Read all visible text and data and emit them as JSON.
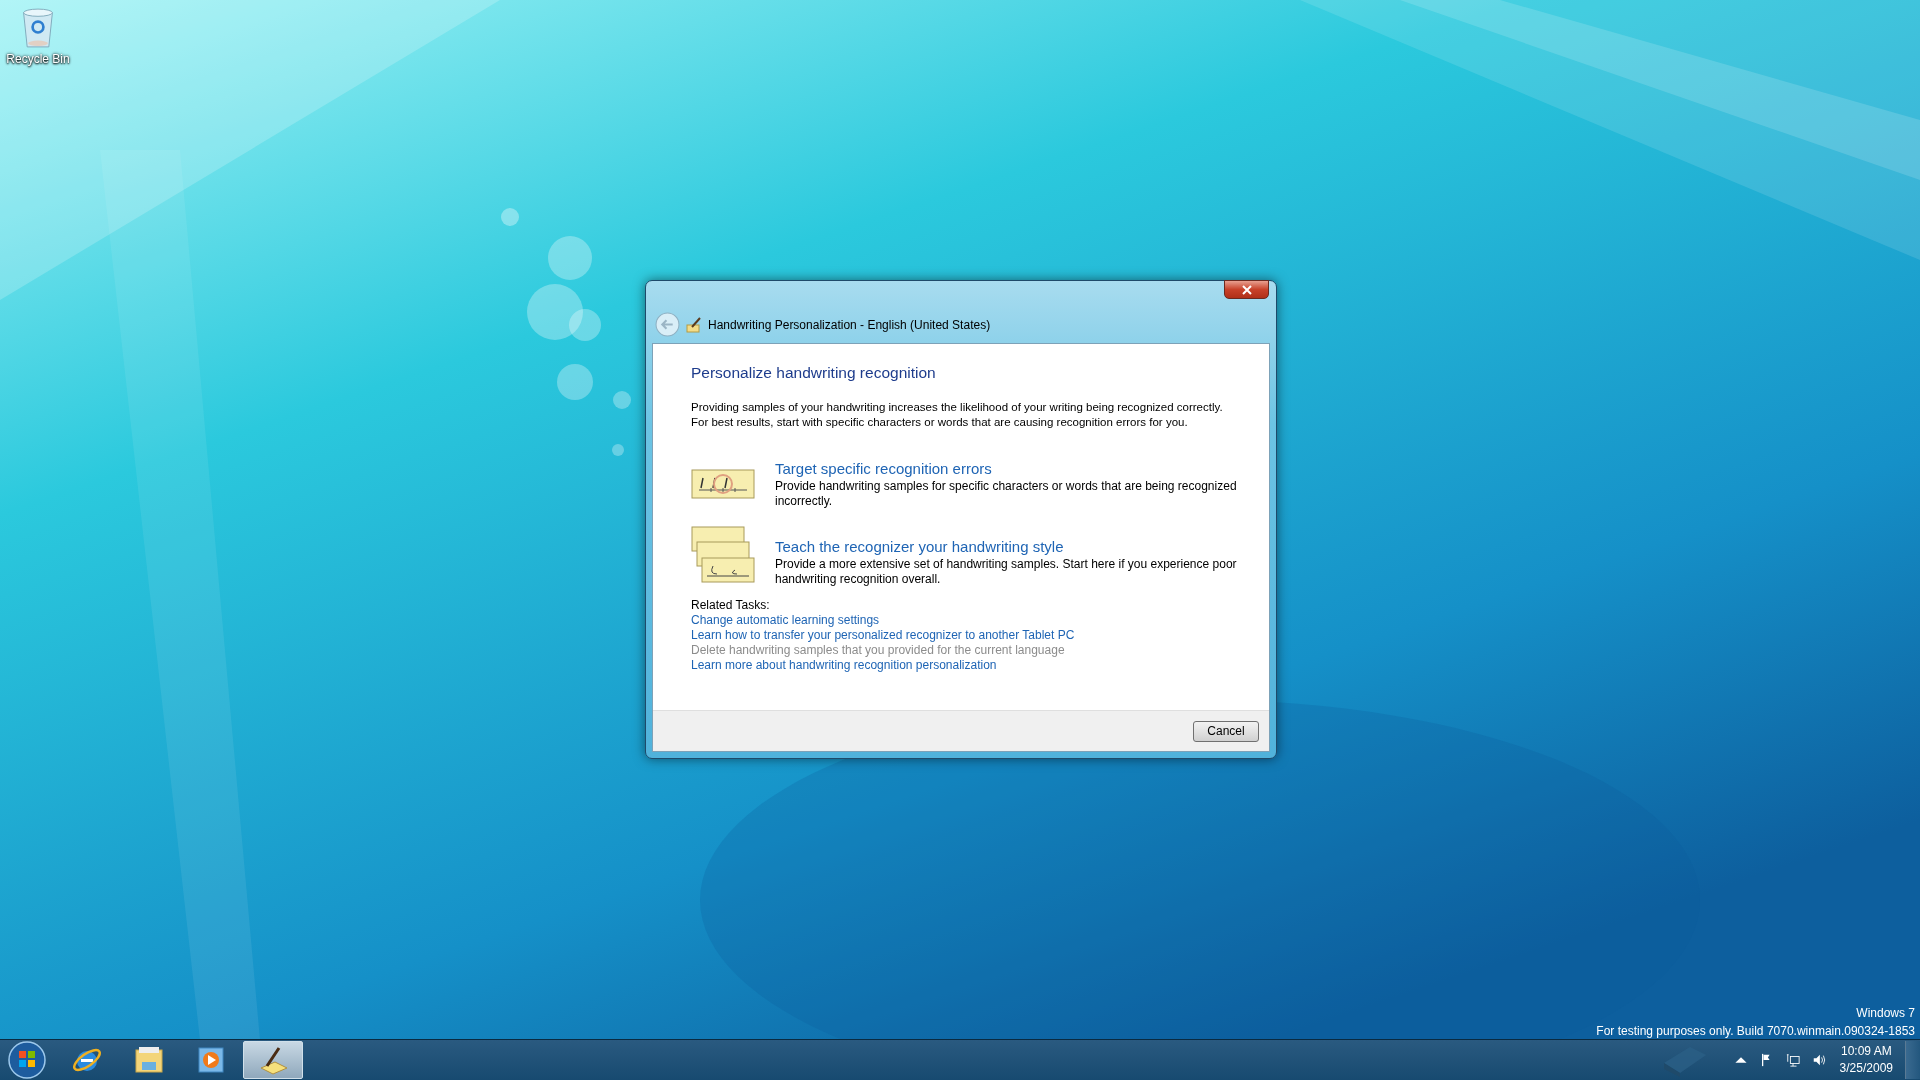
{
  "desktop": {
    "icons": [
      {
        "label": "Recycle Bin"
      }
    ],
    "build_notice": [
      "Windows 7",
      "For testing purposes only. Build 7070.winmain.090324-1853"
    ]
  },
  "dialog": {
    "title": "Handwriting Personalization - English (United States)",
    "heading": "Personalize handwriting recognition",
    "intro": [
      "Providing samples of your handwriting increases the likelihood of your writing being recognized correctly.",
      "For best results, start with specific characters or words that are causing recognition errors for you."
    ],
    "options": [
      {
        "kind": "target",
        "title": "Target specific recognition errors",
        "description": "Provide handwriting samples for specific characters or words that are being recognized incorrectly."
      },
      {
        "kind": "teach",
        "title": "Teach the recognizer your handwriting style",
        "description": "Provide a more extensive set of handwriting samples. Start here if you experience poor handwriting recognition overall."
      }
    ],
    "related_tasks": {
      "label": "Related Tasks:",
      "links": [
        {
          "text": "Change automatic learning settings",
          "disabled": false
        },
        {
          "text": "Learn how to transfer your personalized recognizer to another Tablet PC",
          "disabled": false
        },
        {
          "text": "Delete handwriting samples that you provided for the current language",
          "disabled": true
        },
        {
          "text": "Learn more about handwriting recognition personalization",
          "disabled": false
        }
      ]
    },
    "buttons": [
      "Cancel"
    ]
  },
  "taskbar": {
    "apps": [
      {
        "kind": "browser",
        "selected": false
      },
      {
        "kind": "folder",
        "selected": false
      },
      {
        "kind": "media",
        "selected": false
      },
      {
        "kind": "handwriting",
        "selected": true
      }
    ],
    "clock": {
      "time": "10:09 AM",
      "date": "3/25/2009"
    }
  }
}
